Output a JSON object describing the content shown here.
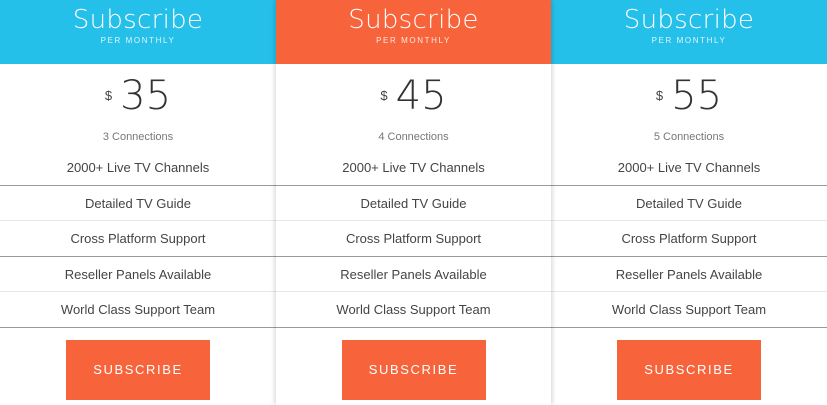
{
  "colors": {
    "header_blue": "#25c0ea",
    "header_orange": "#f7643b",
    "button": "#f7643b"
  },
  "plans": [
    {
      "title": "Subscribe",
      "subtitle": "PER MONTHLY",
      "currency": "$",
      "price": "35",
      "connections": "3 Connections",
      "features": [
        "2000+ Live TV Channels",
        "Detailed TV Guide",
        "Cross Platform Support",
        "Reseller Panels Available",
        "World Class Support Team"
      ],
      "button_label": "SUBSCRIBE"
    },
    {
      "title": "Subscribe",
      "subtitle": "PER MONTHLY",
      "currency": "$",
      "price": "45",
      "connections": "4 Connections",
      "features": [
        "2000+ Live TV Channels",
        "Detailed TV Guide",
        "Cross Platform Support",
        "Reseller Panels Available",
        "World Class Support Team"
      ],
      "button_label": "SUBSCRIBE"
    },
    {
      "title": "Subscribe",
      "subtitle": "PER MONTHLY",
      "currency": "$",
      "price": "55",
      "connections": "5 Connections",
      "features": [
        "2000+ Live TV Channels",
        "Detailed TV Guide",
        "Cross Platform Support",
        "Reseller Panels Available",
        "World Class Support Team"
      ],
      "button_label": "SUBSCRIBE"
    }
  ]
}
